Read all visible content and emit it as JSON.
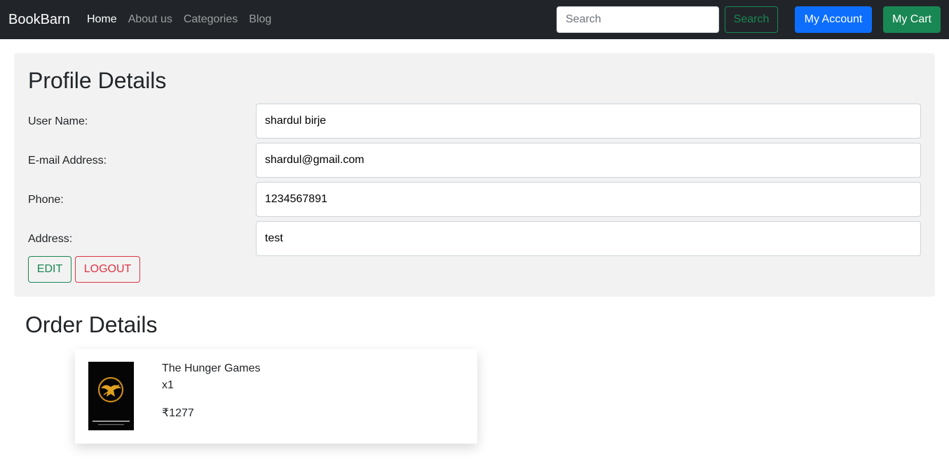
{
  "navbar": {
    "brand": "BookBarn",
    "links": [
      {
        "label": "Home"
      },
      {
        "label": "About us"
      },
      {
        "label": "Categories"
      },
      {
        "label": "Blog"
      }
    ],
    "search_placeholder": "Search",
    "search_button": "Search",
    "account_button": "My Account",
    "cart_button": "My Cart",
    "colors": {
      "bar": "#212529",
      "account": "#0d6efd",
      "cart": "#198754"
    }
  },
  "profile": {
    "title": "Profile Details",
    "fields": [
      {
        "label": "User Name:",
        "value": "shardul birje"
      },
      {
        "label": "E-mail Address:",
        "value": "shardul@gmail.com"
      },
      {
        "label": "Phone:",
        "value": "1234567891"
      },
      {
        "label": "Address:",
        "value": "test"
      }
    ],
    "edit_button": "EDIT",
    "logout_button": "LOGOUT"
  },
  "orders": {
    "title": "Order Details",
    "items": [
      {
        "name": "The Hunger Games",
        "quantity": "x1",
        "price": "₹1277",
        "cover_icon": "mockingjay-book-cover"
      }
    ]
  }
}
